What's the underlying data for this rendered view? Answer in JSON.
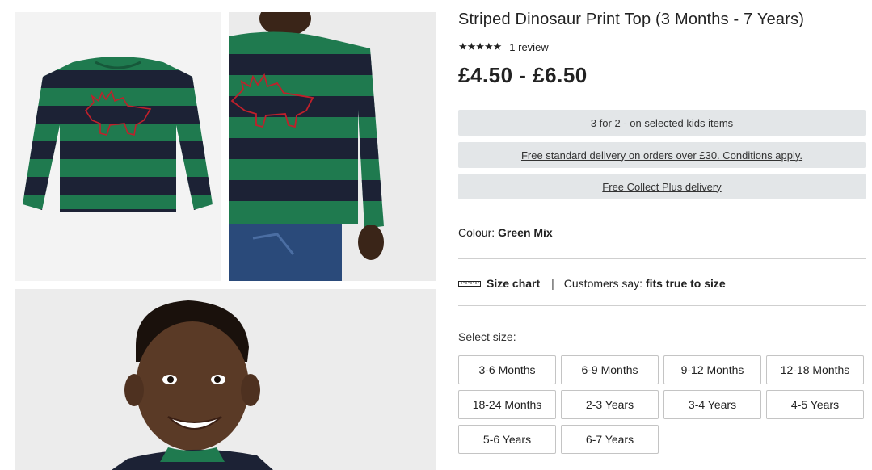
{
  "product": {
    "title": "Striped Dinosaur Print Top (3 Months - 7 Years)",
    "stars": "★★★★★",
    "review_link": "1 review",
    "price": "£4.50 - £6.50"
  },
  "promotions": [
    "3 for 2 - on selected kids items",
    "Free standard delivery on orders over £30. Conditions apply.",
    "Free Collect Plus delivery"
  ],
  "colour": {
    "label": "Colour:",
    "value": "Green Mix"
  },
  "size_info": {
    "size_chart": "Size chart",
    "separator": "|",
    "customers_say_label": "Customers say:",
    "customers_say_value": "fits true to size"
  },
  "select_size_label": "Select size:",
  "sizes": [
    "3-6 Months",
    "6-9 Months",
    "9-12 Months",
    "12-18 Months",
    "18-24 Months",
    "2-3 Years",
    "3-4 Years",
    "4-5 Years",
    "5-6 Years",
    "6-7 Years"
  ],
  "colors": {
    "stripe_green": "#1f7a4f",
    "stripe_navy": "#1c2235",
    "dino_red": "#c0202b",
    "promo_bg": "#e3e6e8"
  },
  "icons": {
    "ruler": "ruler-icon"
  }
}
